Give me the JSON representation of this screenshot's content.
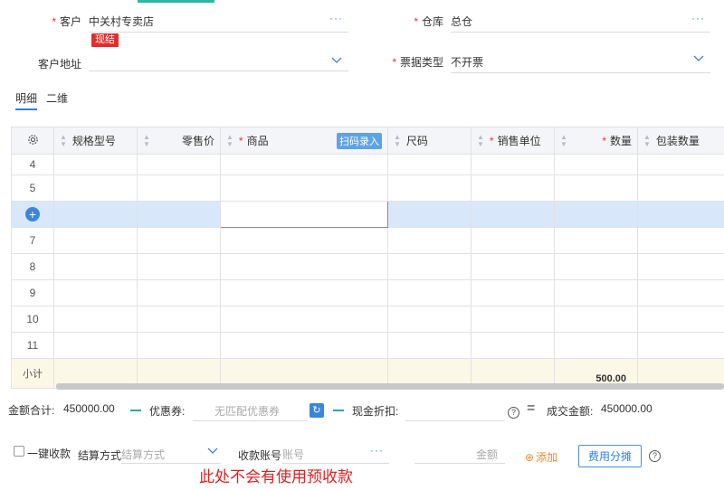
{
  "header": {
    "customer_label": "客户",
    "customer_value": "中关村专卖店",
    "customer_badge": "现结",
    "warehouse_label": "仓库",
    "warehouse_value": "总仓",
    "address_label": "客户地址",
    "address_value": "",
    "invoice_label": "票据类型",
    "invoice_value": "不开票",
    "more_dots": "···",
    "required_mark": "*"
  },
  "tabs": [
    {
      "label": "明细",
      "active": true
    },
    {
      "label": "二维",
      "active": false
    }
  ],
  "grid": {
    "columns": [
      {
        "label": "",
        "icon": "gear-icon"
      },
      {
        "label": "规格型号",
        "sortable": true,
        "required": false
      },
      {
        "label": "零售价",
        "sortable": true,
        "required": false
      },
      {
        "label": "商品",
        "sortable": true,
        "required": true,
        "button": "扫码录入"
      },
      {
        "label": "尺码",
        "sortable": true,
        "required": false
      },
      {
        "label": "销售单位",
        "sortable": true,
        "required": true
      },
      {
        "label": "数量",
        "sortable": true,
        "required": true
      },
      {
        "label": "包装数量",
        "sortable": true,
        "required": false
      }
    ],
    "rows": [
      "4",
      "5",
      "",
      "7",
      "8",
      "9",
      "10",
      "11"
    ],
    "selected_row": 2,
    "subtotal_label": "小计",
    "subtotal_qty": "500.00"
  },
  "footer": {
    "total_label": "金额合计:",
    "total_value": "450000.00",
    "coupon_label": "优惠券:",
    "coupon_placeholder": "无匹配优惠券",
    "cash_discount_label": "现金折扣:",
    "deal_label": "成交金额:",
    "deal_value": "450000.00",
    "quick_collect_label": "一键收款",
    "settle_label": "结算方式",
    "settle_placeholder": "结算方式",
    "account_label": "收款账号",
    "account_placeholder": "账号",
    "amount_placeholder": "金额",
    "add_label": "添加",
    "split_label": "费用分摊",
    "note": "此处不会有使用预收款"
  },
  "colors": {
    "accent": "#2f7fd9",
    "required": "#e33333",
    "badge": "#e02d2d",
    "selected_row": "#d9e7fb",
    "subtotal_row": "#fcf8e8"
  }
}
